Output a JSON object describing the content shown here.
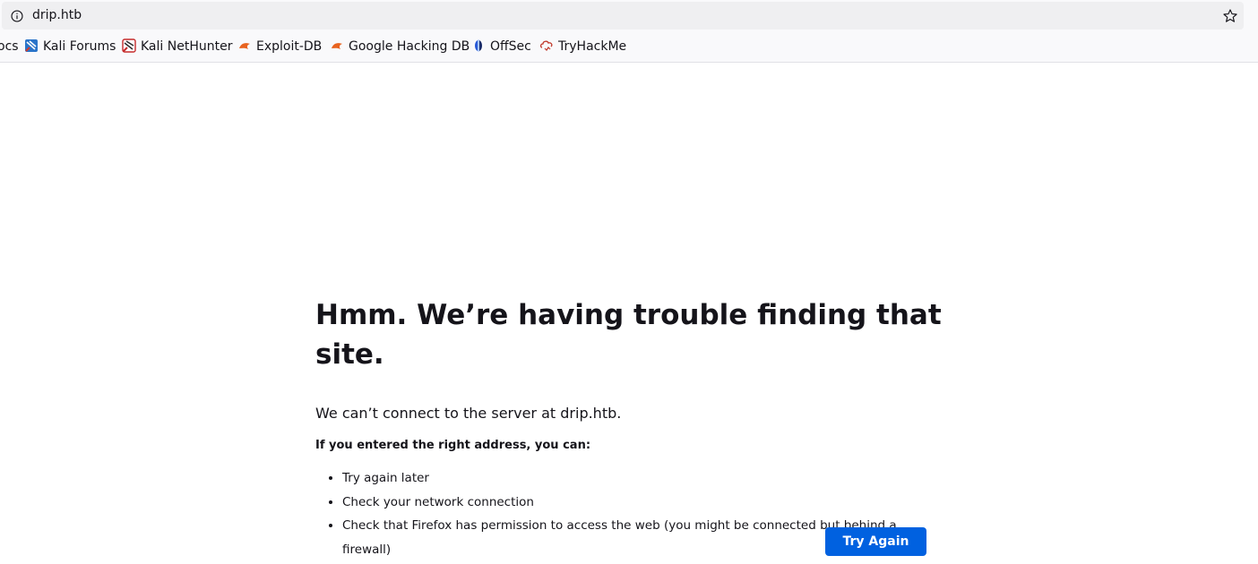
{
  "browser": {
    "url": "drip.htb",
    "bookmarks": [
      {
        "label": "ocs",
        "icon": "kali-docs-icon"
      },
      {
        "label": "Kali Forums",
        "icon": "kali-forums-icon"
      },
      {
        "label": "Kali NetHunter",
        "icon": "kali-nethunter-icon"
      },
      {
        "label": "Exploit-DB",
        "icon": "exploit-db-icon"
      },
      {
        "label": "Google Hacking DB",
        "icon": "google-hacking-db-icon"
      },
      {
        "label": "OffSec",
        "icon": "offsec-icon"
      },
      {
        "label": "TryHackMe",
        "icon": "tryhackme-icon"
      }
    ]
  },
  "error_page": {
    "title": "Hmm. We’re having trouble finding that site.",
    "description": "We can’t connect to the server at drip.htb.",
    "subheading": "If you entered the right address, you can:",
    "tips": [
      "Try again later",
      "Check your network connection",
      "Check that Firefox has permission to access the web (you might be connected but behind a firewall)"
    ],
    "button_label": "Try Again"
  },
  "colors": {
    "accent": "#0061e0",
    "text": "#15141a",
    "urlbar_bg": "#efeff1"
  }
}
